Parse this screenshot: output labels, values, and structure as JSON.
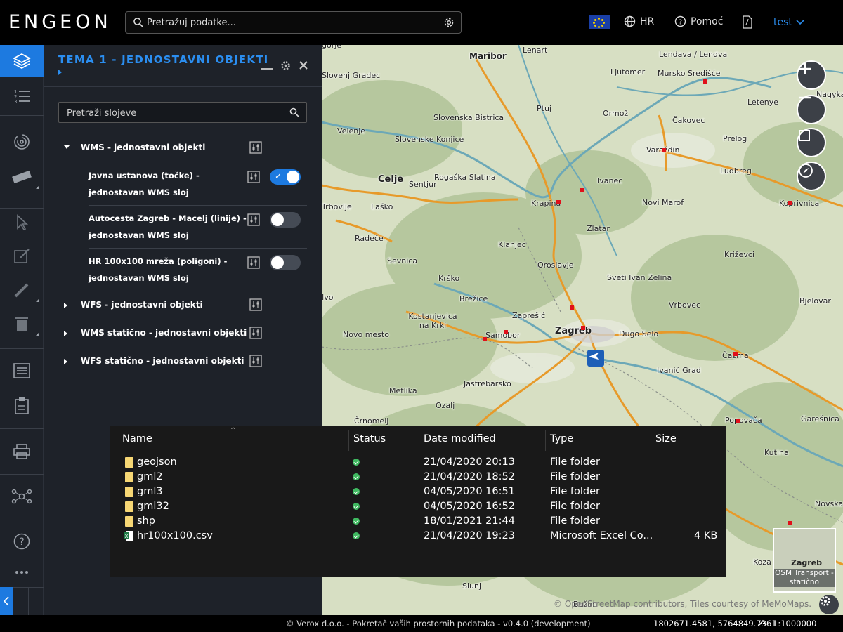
{
  "app": {
    "logo": "ENGEON"
  },
  "topbar": {
    "search_placeholder": "Pretražuj podatke...",
    "language": "HR",
    "help": "Pomoć",
    "user": "test"
  },
  "panel": {
    "title": "TEMA 1 - JEDNOSTAVNI OBJEKTI",
    "search_placeholder": "Pretraži slojeve",
    "groups": [
      {
        "label": "WMS - jednostavni objekti",
        "expanded": true,
        "layers": [
          {
            "label": "Javna ustanova (točke) - jednostavan WMS sloj",
            "enabled": true
          },
          {
            "label": "Autocesta Zagreb - Macelj (linije) - jednostavan WMS sloj",
            "enabled": false
          },
          {
            "label": "HR 100x100 mreža (poligoni) - jednostavan WMS sloj",
            "enabled": false
          }
        ]
      },
      {
        "label": "WFS - jednostavni objekti",
        "expanded": false
      },
      {
        "label": "WMS statično - jednostavni objekti",
        "expanded": false
      },
      {
        "label": "WFS statično - jednostavni objekti",
        "expanded": false
      }
    ]
  },
  "map": {
    "labels": [
      "Maribor",
      "Lenart",
      "Lendava / Lendva",
      "Ljutomer",
      "Mursko Središće",
      "Nagykan",
      "Slovenj Gradec",
      "Slovenska Bistrica",
      "Ptuj",
      "Ormož",
      "Letenye",
      "Čakovec",
      "Velenje",
      "Slovenske Konjice",
      "Prelog",
      "Varaždin",
      "Rogaška Slatina",
      "Ludbreg",
      "Celje",
      "Šentjur",
      "Ivanec",
      "Krapina",
      "Novi Marof",
      "Koprivnica",
      "Trbovlje",
      "Laško",
      "Zlatar",
      "Radeče",
      "Klanjec",
      "Križevci",
      "Sevnica",
      "Oroslavje",
      "Krško",
      "Sveti Ivan Zelina",
      "Brežice",
      "Vrbovec",
      "Bjelovar",
      "Kostanjevica na Krki",
      "Zaprešić",
      "Novo mesto",
      "Zagreb",
      "Samobor",
      "Dugo Selo",
      "Čazma",
      "Jastrebarsko",
      "Ivanić Grad",
      "Metlika",
      "Ozalj",
      "Črnomelj",
      "Popovača",
      "Garešnica",
      "Kutina",
      "Novska",
      "Koza",
      "Slunj",
      "Bužim",
      "gorje",
      "Ivo"
    ],
    "attribution": "© OpenStreetMap contributors, Tiles courtesy of MeMoMaps.",
    "basemap_caption": "OSM Transport - statično",
    "basemap_city": "Zagreb"
  },
  "explorer": {
    "columns": [
      "Name",
      "Status",
      "Date modified",
      "Type",
      "Size"
    ],
    "rows": [
      {
        "name": "geojson",
        "date": "21/04/2020 20:13",
        "type": "File folder",
        "size": "",
        "kind": "folder"
      },
      {
        "name": "gml2",
        "date": "21/04/2020 18:52",
        "type": "File folder",
        "size": "",
        "kind": "folder"
      },
      {
        "name": "gml3",
        "date": "04/05/2020 16:51",
        "type": "File folder",
        "size": "",
        "kind": "folder"
      },
      {
        "name": "gml32",
        "date": "04/05/2020 16:52",
        "type": "File folder",
        "size": "",
        "kind": "folder"
      },
      {
        "name": "shp",
        "date": "18/01/2021 21:44",
        "type": "File folder",
        "size": "",
        "kind": "folder"
      },
      {
        "name": "hr100x100.csv",
        "date": "21/04/2020 19:23",
        "type": "Microsoft Excel Co...",
        "size": "4 KB",
        "kind": "csv"
      }
    ]
  },
  "statusbar": {
    "credits": "© Verox d.o.o. - Pokretač vaših prostornih podataka - v0.4.0 (development)",
    "coordinates": "1802671.4581, 5764849.7361",
    "scale": "1:1000000"
  },
  "colors": {
    "accent": "#1d7ae0",
    "panel_bg": "#1e2229",
    "poi": "#e0101a",
    "map_bg": "#d7dfc3"
  }
}
